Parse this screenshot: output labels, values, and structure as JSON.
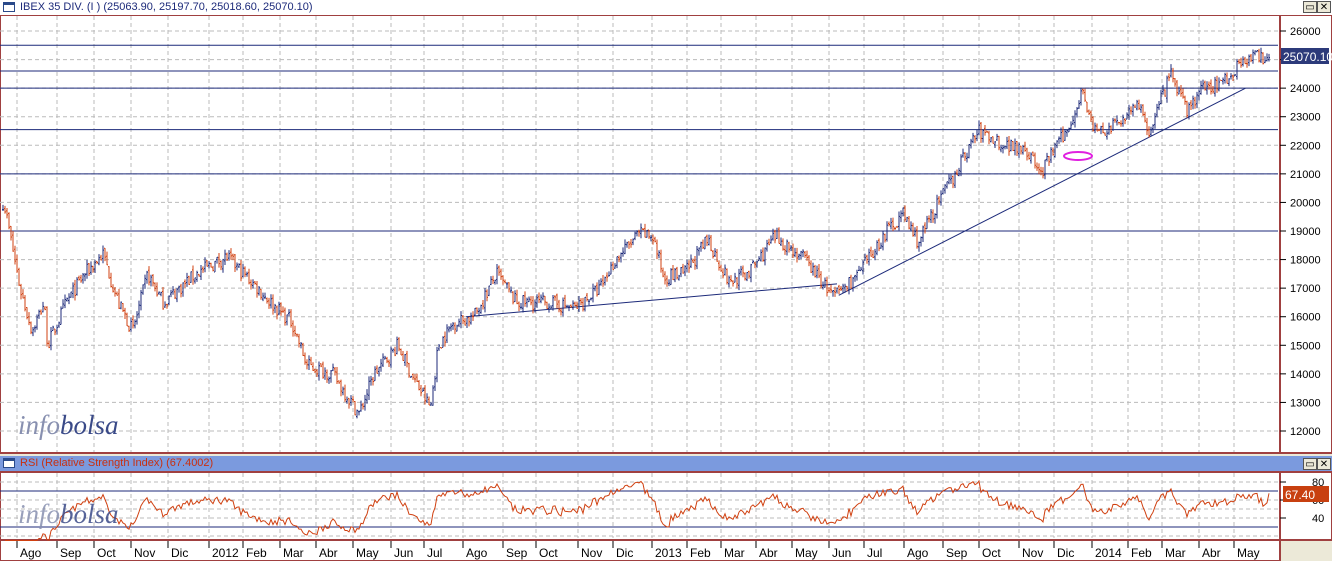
{
  "price_panel": {
    "title": "IBEX 35 DIV. (I ) (25063.90, 25197.70, 25018.60, 25070.10)",
    "last_value": "25070.10",
    "watermark": "infobolsa"
  },
  "rsi_panel": {
    "title": "RSI (Relative Strength Index) (67.4002)",
    "last_value": "67.40",
    "watermark": "infobolsa"
  },
  "window_buttons": {
    "restore": "▭",
    "close": "✕"
  },
  "colors": {
    "up": "#1c2a7a",
    "down": "#d04010",
    "rsi": "#d04010",
    "level": "#1c2a7a",
    "ellipse": "#e020e0"
  },
  "chart_data": [
    {
      "type": "ohlc",
      "title": "IBEX 35 DIV.",
      "y_ticks": [
        26000,
        25000,
        24000,
        23000,
        22000,
        21000,
        20000,
        19000,
        18000,
        17000,
        16000,
        15000,
        14000,
        13000,
        12000
      ],
      "ylim": [
        11800,
        26500
      ],
      "x_labels": [
        "Ago",
        "Sep",
        "Oct",
        "Nov",
        "Dic",
        "2012",
        "Feb",
        "Mar",
        "Abr",
        "May",
        "Jun",
        "Jul",
        "Ago",
        "Sep",
        "Oct",
        "Nov",
        "Dic",
        "2013",
        "Feb",
        "Mar",
        "Abr",
        "May",
        "Jun",
        "Jul",
        "Ago",
        "Sep",
        "Oct",
        "Nov",
        "Dic",
        "2014",
        "Feb",
        "Mar",
        "Abr",
        "May"
      ],
      "horizontal_levels": [
        25500,
        24600,
        24000,
        22550,
        21000,
        19000
      ],
      "trendlines": [
        [
          [
            12.4,
            16000
          ],
          [
            22.6,
            17150
          ]
        ],
        [
          [
            22.65,
            16750
          ],
          [
            33.7,
            24000
          ]
        ]
      ],
      "close_path_month_index": [
        [
          0,
          20000
        ],
        [
          0.4,
          17000
        ],
        [
          0.7,
          15500
        ],
        [
          1,
          16500
        ],
        [
          1.1,
          15000
        ],
        [
          1.6,
          16500
        ],
        [
          2.1,
          17500
        ],
        [
          2.6,
          18200
        ],
        [
          3,
          16500
        ],
        [
          3.4,
          15500
        ],
        [
          3.8,
          17500
        ],
        [
          4.2,
          16500
        ],
        [
          5,
          17500
        ],
        [
          5.9,
          18100
        ],
        [
          6.6,
          17200
        ],
        [
          7.1,
          16500
        ],
        [
          7.7,
          15800
        ],
        [
          8.1,
          14300
        ],
        [
          8.8,
          14000
        ],
        [
          9.5,
          12600
        ],
        [
          9.9,
          14000
        ],
        [
          10.6,
          15000
        ],
        [
          11,
          14000
        ],
        [
          11.5,
          12800
        ],
        [
          11.7,
          15000
        ],
        [
          12.1,
          15800
        ],
        [
          12.6,
          16000
        ],
        [
          13.2,
          17500
        ],
        [
          13.8,
          16500
        ],
        [
          14.6,
          16500
        ],
        [
          15.3,
          16300
        ],
        [
          16,
          17000
        ],
        [
          16.4,
          18000
        ],
        [
          17,
          18900
        ],
        [
          17.4,
          18800
        ],
        [
          17.7,
          17400
        ],
        [
          18.3,
          17500
        ],
        [
          19,
          18700
        ],
        [
          19.6,
          17200
        ],
        [
          20.2,
          17600
        ],
        [
          20.9,
          18800
        ],
        [
          21.7,
          18000
        ],
        [
          22.5,
          16700
        ],
        [
          23.2,
          17500
        ],
        [
          23.9,
          19000
        ],
        [
          24.3,
          19600
        ],
        [
          24.7,
          18600
        ],
        [
          25.1,
          19700
        ],
        [
          25.6,
          20800
        ],
        [
          26.3,
          22500
        ],
        [
          27,
          22000
        ],
        [
          27.5,
          22000
        ],
        [
          28,
          21000
        ],
        [
          28.4,
          22000
        ],
        [
          28.7,
          22500
        ],
        [
          29.1,
          24000
        ],
        [
          29.4,
          22500
        ],
        [
          29.8,
          22500
        ],
        [
          30.2,
          22900
        ],
        [
          30.6,
          23500
        ],
        [
          31,
          22500
        ],
        [
          31.6,
          24500
        ],
        [
          32,
          23200
        ],
        [
          32.5,
          24000
        ],
        [
          33,
          24200
        ],
        [
          33.4,
          24600
        ],
        [
          33.6,
          25070
        ]
      ],
      "last": 25070.1
    },
    {
      "type": "line",
      "title": "RSI (Relative Strength Index)",
      "period": 14,
      "y_ticks": [
        80,
        60,
        40
      ],
      "levels": [
        70,
        30
      ],
      "ylim": [
        10,
        90
      ],
      "last": 67.4002
    }
  ]
}
